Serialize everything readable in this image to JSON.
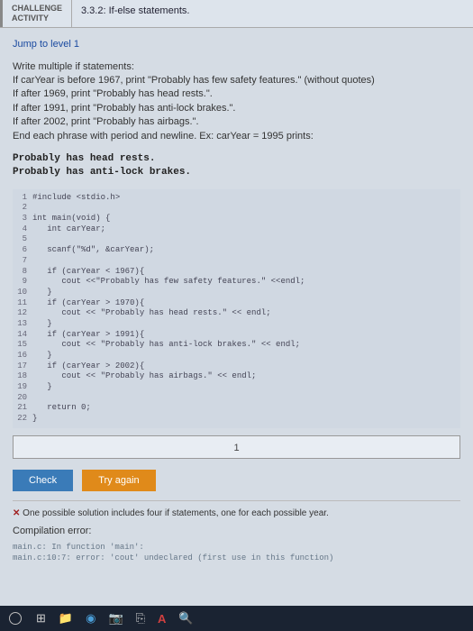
{
  "header": {
    "label_top": "CHALLENGE",
    "label_bottom": "ACTIVITY",
    "title": "3.3.2: If-else statements."
  },
  "jump_link": "Jump to level 1",
  "prompt_lines": [
    "Write multiple if statements:",
    "If carYear is before 1967, print \"Probably has few safety features.\" (without quotes)",
    "If after 1969, print \"Probably has head rests.\".",
    "If after 1991, print \"Probably has anti-lock brakes.\".",
    "If after 2002, print \"Probably has airbags.\".",
    "End each phrase with period and newline. Ex: carYear = 1995 prints:"
  ],
  "output_lines": [
    "Probably has head rests.",
    "Probably has anti-lock brakes."
  ],
  "code": [
    "#include <stdio.h>",
    "",
    "int main(void) {",
    "   int carYear;",
    "",
    "   scanf(\"%d\", &carYear);",
    "",
    "   if (carYear < 1967){",
    "      cout <<\"Probably has few safety features.\" <<endl;",
    "   }",
    "   if (carYear > 1970){",
    "      cout << \"Probably has head rests.\" << endl;",
    "   }",
    "   if (carYear > 1991){",
    "      cout << \"Probably has anti-lock brakes.\" << endl;",
    "   }",
    "   if (carYear > 2002){",
    "      cout << \"Probably has airbags.\" << endl;",
    "   }",
    "",
    "   return 0;",
    "}"
  ],
  "answer_value": "1",
  "buttons": {
    "check": "Check",
    "try": "Try again"
  },
  "feedback": {
    "line1": "One possible solution includes four if statements, one for each possible year.",
    "title": "Compilation error:",
    "err1": "main.c: In function 'main':",
    "err2": "main.c:10:7: error: 'cout' undeclared (first use in this function)"
  }
}
